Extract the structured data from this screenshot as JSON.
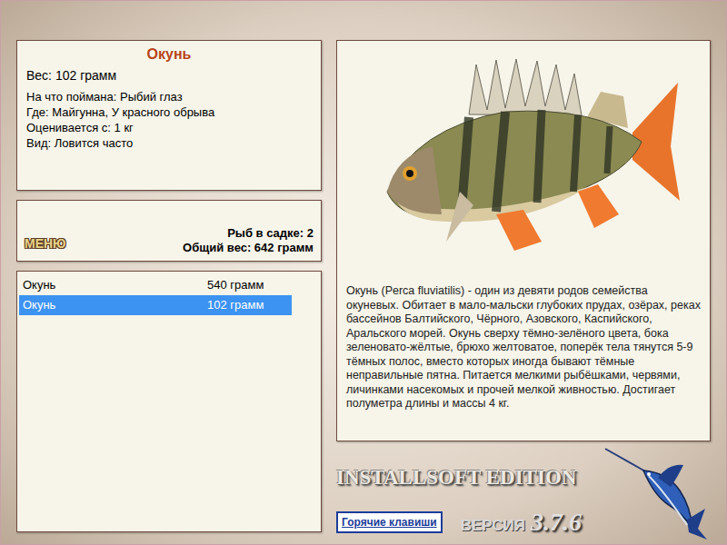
{
  "fish_card": {
    "title": "Окунь",
    "weight": "Вес: 102 грамм",
    "details": [
      "На что поймана: Рыбий глаз",
      "Где: Майгунна, У красного обрыва",
      "Оценивается с: 1 кг",
      "Вид: Ловится часто"
    ]
  },
  "keepnet": {
    "menu_button": "МЕНЮ",
    "count": "Рыб в садке: 2",
    "total": "Общий вес: 642 грамм"
  },
  "catch_list": [
    {
      "name": "Окунь",
      "weight": "540 грамм",
      "selected": false
    },
    {
      "name": "Окунь",
      "weight": "102 грамм",
      "selected": true
    }
  ],
  "description": "Окунь (Perca fluviatilis) - один из девяти родов семейства окуневых. Обитает в мало-мальски глубоких прудах, озёрах, реках бассейнов Балтийского, Чёрного, Азовского, Каспийского, Аральского морей. Окунь сверху тёмно-зелёного цвета, бока зеленовато-жёлтые, брюхо желтоватое, поперёк тела тянутся 5-9 тёмных полос, вместо которых иногда бывают тёмные неправильные пятна. Питается мелкими рыбёшками, червями, личинками насекомых и прочей мелкой живностью. Достигает полуметра длины и массы 4 кг.",
  "branding": {
    "edition": "INSTALLSOFT EDITION",
    "version_label": "ВЕРСИЯ",
    "version": "3.7.6"
  },
  "hotkeys_button": "Горячие клавиши"
}
